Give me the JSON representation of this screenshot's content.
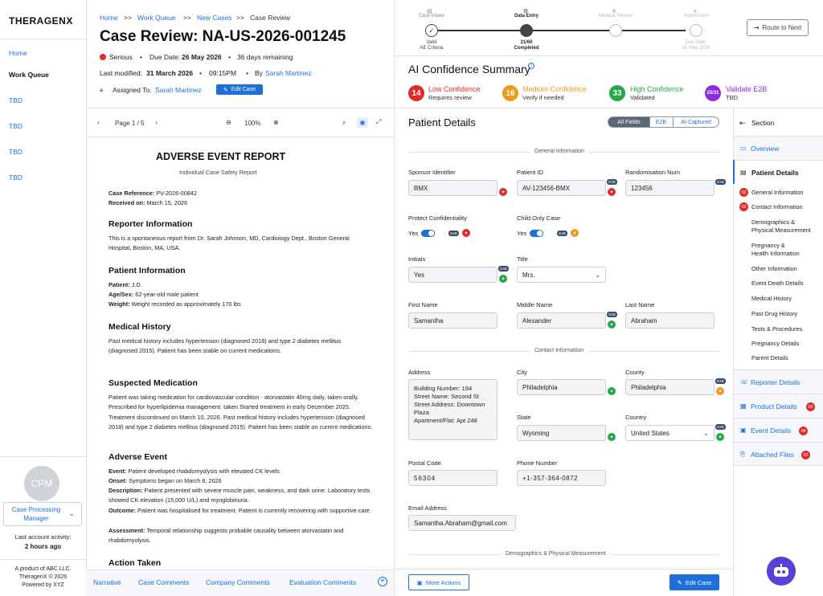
{
  "nav": {
    "logo": "THERAGENX",
    "items": [
      "Home",
      "Work Queue",
      "TBD",
      "TBD",
      "TBD",
      "TBD"
    ],
    "avatar_initials": "CPM",
    "role": "Case Processing Manager",
    "last_activity_label": "Last account activity:",
    "last_activity_value": "2 hours ago",
    "footer": [
      "A product of ABC LLC.",
      "TheragenX © 2026",
      "Powered by XYZ"
    ]
  },
  "header": {
    "breadcrumb": [
      "Home",
      "Work Queue",
      "New Cases",
      "Case Review"
    ],
    "breadcrumb_sep": ">>",
    "title": "Case Review: NA-US-2026-001245",
    "seriousness": "Serious",
    "due_date_label": "Due Date:",
    "due_date": "26 May 2026",
    "days_remaining": "36 days remaining",
    "last_modified_label": "Last modified:",
    "last_modified_date": "31 March 2026",
    "last_modified_time": "09:15PM",
    "by_label": "By",
    "modified_by": "Sarah Martinez",
    "assigned_label": "Assigned To:",
    "assigned_to": "Sarah Martinez",
    "edit_case": "Edit Case"
  },
  "progress": {
    "steps": [
      {
        "label": "Case Intake",
        "sub1": "Valid",
        "sub2": "AE Criteria"
      },
      {
        "label": "Data Entry",
        "sub1": "21/60",
        "sub2": "Completed"
      },
      {
        "label": "Medical Review",
        "sub1": "",
        "sub2": ""
      },
      {
        "label": "Submission",
        "sub1": "Due Date:",
        "sub2": "26 May 2026"
      }
    ],
    "route_button": "Route to Next"
  },
  "confidence": {
    "title": "AI Confidence Summary",
    "items": [
      {
        "count": "14",
        "label": "Low Confidence",
        "sub": "Requires review",
        "color": "#e12b2b"
      },
      {
        "count": "16",
        "label": "Medium Confidence",
        "sub": "Verify if needed",
        "color": "#f09a1a"
      },
      {
        "count": "33",
        "label": "High Confidence",
        "sub": "Validated",
        "color": "#22a84a"
      },
      {
        "count": "25/31",
        "label": "Validate E2B",
        "sub": "TBD",
        "color": "#8a2be2"
      }
    ]
  },
  "doc": {
    "page": "Page 1 / 5",
    "zoom": "100%",
    "title": "ADVERSE EVENT REPORT",
    "subtitle": "Individual Case Safety Report",
    "case_ref_label": "Case Reference:",
    "case_ref": "PV-2026-00842",
    "received_label": "Received on:",
    "received": "March 15, 2026",
    "sections": {
      "reporter_h": "Reporter Information",
      "reporter_p": "This is a spontaneous report from Dr. Sarah Johnson, MD, Cardiology Dept., Boston General Hospital, Boston, MA, USA.",
      "patient_h": "Patient Information",
      "patient_l1": "Patient:",
      "patient_v1": "J.D.",
      "patient_l2": "Age/Sex:",
      "patient_v2": "62-year-old male patient",
      "patient_l3": "Weight:",
      "patient_v3": "Weight recorded as approximately 170 lbs",
      "history_h": "Medical History",
      "history_p": "Past medical history includes hypertension (diagnosed 2018) and type 2 diabetes mellitus (diagnosed 2015). Patient has been stable on current medications.",
      "med_h": "Suspected Medication",
      "med_p": "Patient was taking medication for cardiovascular condition - atorvastatin 40mg daily, taken orally. Prescribed for hyperlipidemia management. taken Started treatment in early December 2025. Treatment discontinued on March 10, 2026. Past medical history includes hypertension (diagnosed 2018) and type 2 diabetes mellitus (diagnosed 2015). Patient has been stable on current medications.",
      "ae_h": "Adverse Event",
      "ae_l1": "Event:",
      "ae_v1": "Patient developed rhabdomyolysis with elevated CK levels",
      "ae_l2": "Onset:",
      "ae_v2": "Symptoms began on March 8, 2026",
      "ae_l3": "Description:",
      "ae_v3": "Patient presented with severe muscle pain, weakness, and dark urine. Laboratory tests showed CK elevation (15,000 U/L) and myoglobinuria.",
      "ae_l4": "Outcome:",
      "ae_v4": "Patient was hospitalised for treatment. Patient is currently recovering with supportive care.",
      "ae_l5": "Assessment:",
      "ae_v5": "Temporal relationship suggests probable causality between atorvastatin and rhabdomyolysis.",
      "action_h": "Action Taken"
    },
    "tabs": [
      "Narrative",
      "Case Comments",
      "Company Comments",
      "Evaluation Comments"
    ]
  },
  "form": {
    "title": "Patient Details",
    "segments": [
      "All Fields",
      "E2B",
      "AI-Captured"
    ],
    "general_hdr": "General Information",
    "contact_hdr": "Contact Information",
    "demo_hdr": "Demographics & Physical Measurement",
    "e2b_tag": "E2B",
    "fields": {
      "sponsor_id_l": "Sponsor Identifier",
      "sponsor_id": "BMX",
      "patient_id_l": "Patient ID",
      "patient_id": "AV-123456-BMX",
      "rand_l": "Randomisation Num",
      "rand": "123456",
      "protect_l": "Protect Confidentiality",
      "protect": "Yes",
      "child_l": "Child Only Case",
      "child": "Yes",
      "initials_l": "Initials",
      "initials": "Yes",
      "title_l": "Title",
      "title": "Mrs.",
      "first_l": "First Name",
      "first": "Samantha",
      "middle_l": "Middle Name",
      "middle": "Alexander",
      "last_l": "Last Name",
      "last": "Abraham",
      "address_l": "Address",
      "address": "Building Number: 194\nStreet Name: Second St\nStreet Address: Downtown Plaza\nApartment/Flat: Apt 248",
      "city_l": "City",
      "city": "Philadelphia",
      "county_l": "County",
      "county": "Philadelphia",
      "state_l": "State",
      "state": "Wyoming",
      "country_l": "Country",
      "country": "United States",
      "postal_l": "Postal Code",
      "postal": "56304",
      "phone_l": "Phone Number",
      "phone": "+1-357-364-0872",
      "email_l": "Email Address",
      "email": "Samantha.Abraham@gmail.com"
    },
    "more_actions": "More Actions",
    "edit_case": "Edit Case"
  },
  "sidenav": {
    "section": "Section",
    "overview": "Overview",
    "patient": "Patient Details",
    "sub": [
      {
        "label": "General Information",
        "count": "02"
      },
      {
        "label": "Contact Information",
        "count": "02"
      },
      {
        "label": "Demographics &\nPhysical Measurement",
        "count": ""
      },
      {
        "label": "Pregnancy &\nHealth Information",
        "count": ""
      },
      {
        "label": "Other Information",
        "count": ""
      },
      {
        "label": "Event Death Details",
        "count": ""
      },
      {
        "label": "Medical History",
        "count": ""
      },
      {
        "label": "Past Drug History",
        "count": ""
      },
      {
        "label": "Tests & Procedures",
        "count": ""
      },
      {
        "label": "Pregnancy Details",
        "count": ""
      },
      {
        "label": "Parent Details",
        "count": ""
      }
    ],
    "reporter": "Reporter Details",
    "product": "Product Details",
    "product_count": "06",
    "event": "Event Details",
    "event_count": "04",
    "files": "Attached Files",
    "files_count": "02"
  },
  "colors": {
    "accent": "#1e6fd9",
    "danger": "#e12b2b",
    "success": "#22a84a",
    "warning": "#f09a1a",
    "e2b": "#8a2be2"
  }
}
